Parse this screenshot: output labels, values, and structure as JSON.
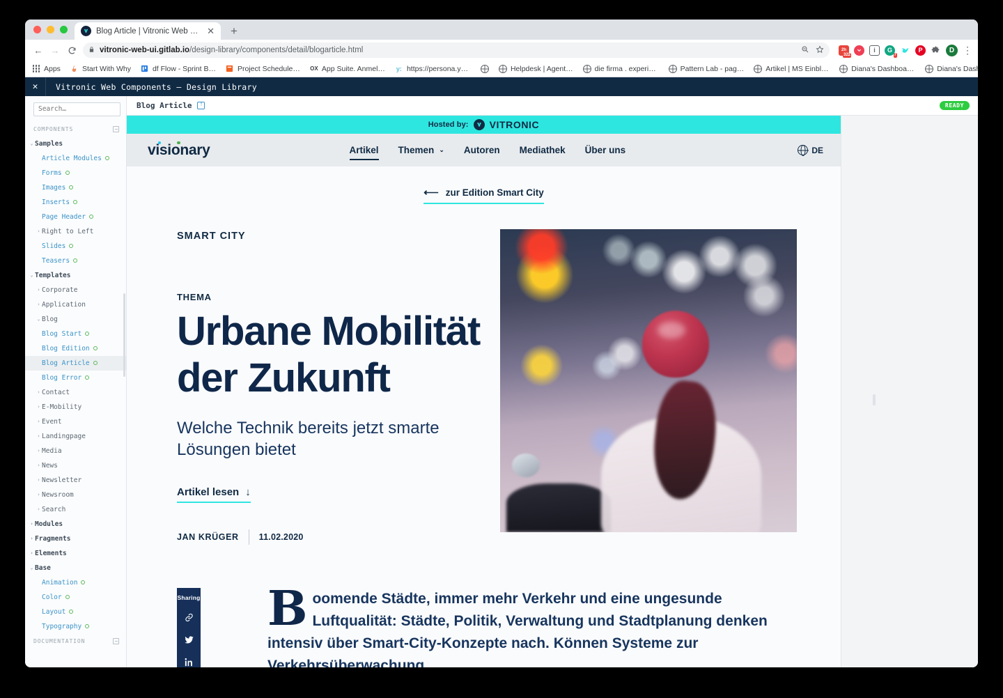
{
  "browser": {
    "tab": {
      "title": "Blog Article | Vitronic Web Com",
      "close": "✕",
      "favicon": "vitronic-favicon"
    },
    "newtab_label": "+",
    "nav": {
      "back": "←",
      "forward": "→",
      "reload": "C"
    },
    "omnibox": {
      "lock": "🔒",
      "url_host": "vitronic-web-ui.gitlab.io",
      "url_path": "/design-library/components/detail/blogarticle.html",
      "zoom_icon": "⊖",
      "star_icon": "☆"
    },
    "extensions": [
      {
        "name": "tab-counter-extension",
        "label": "2h",
        "badge": "322",
        "color": "#e8453c"
      },
      {
        "name": "pocket-extension",
        "label": "",
        "color": "#ef3f56"
      },
      {
        "name": "info-extension",
        "label": "",
        "color": "#ffffff"
      },
      {
        "name": "grammarly-extension",
        "label": "G",
        "badge": "7",
        "color": "#11a683"
      },
      {
        "name": "bird-extension",
        "label": "",
        "color": "#2ee6e0"
      },
      {
        "name": "pinterest-extension",
        "label": "",
        "color": "#e60023"
      },
      {
        "name": "puzzle-extension",
        "label": "",
        "color": "#5f6368"
      }
    ],
    "profile_initial": "D",
    "menu_icon": "⋮",
    "bookmarks": [
      {
        "label": "Apps",
        "icon": "apps-grid-icon"
      },
      {
        "label": "Start With Why",
        "icon": "flame-icon"
      },
      {
        "label": "df Flow - Sprint B…",
        "icon": "board-icon"
      },
      {
        "label": "Project Schedule…",
        "icon": "sheet-icon"
      },
      {
        "label": "App Suite. Anmel…",
        "icon": "ox-icon"
      },
      {
        "label": "https://persona.ya…",
        "icon": "y-icon"
      },
      {
        "label": "",
        "icon": "globe-icon"
      },
      {
        "label": "Helpdesk | Agent…",
        "icon": "globe-icon"
      },
      {
        "label": "die firma . experie…",
        "icon": "globe-icon"
      },
      {
        "label": "Pattern Lab - pag…",
        "icon": "globe-icon"
      },
      {
        "label": "Artikel | MS Einblick",
        "icon": "globe-icon"
      },
      {
        "label": "Diana's Dashboar…",
        "icon": "globe-icon"
      },
      {
        "label": "Diana's Dashboar…",
        "icon": "globe-icon"
      }
    ]
  },
  "app": {
    "close_label": "✕",
    "title": "Vitronic Web Components — Design Library",
    "search_placeholder": "Search…",
    "search_value": "",
    "sections": [
      {
        "label": "COMPONENTS",
        "toggle": "collapse-icon"
      },
      {
        "label": "DOCUMENTATION",
        "toggle": "collapse-icon"
      }
    ],
    "tree": [
      {
        "label": "Samples",
        "level": 1,
        "caret": "⌄",
        "status": false
      },
      {
        "label": "Article Modules",
        "level": 3,
        "caret": "",
        "status": true
      },
      {
        "label": "Forms",
        "level": 3,
        "caret": "",
        "status": true
      },
      {
        "label": "Images",
        "level": 3,
        "caret": "",
        "status": true
      },
      {
        "label": "Inserts",
        "level": 3,
        "caret": "",
        "status": true
      },
      {
        "label": "Page Header",
        "level": 3,
        "caret": "",
        "status": true
      },
      {
        "label": "Right to Left",
        "level": 2,
        "caret": "›",
        "status": false
      },
      {
        "label": "Slides",
        "level": 3,
        "caret": "",
        "status": true
      },
      {
        "label": "Teasers",
        "level": 3,
        "caret": "",
        "status": true
      },
      {
        "label": "Templates",
        "level": 1,
        "caret": "⌄",
        "status": false
      },
      {
        "label": "Corporate",
        "level": 2,
        "caret": "›",
        "status": false
      },
      {
        "label": "Application",
        "level": 2,
        "caret": "›",
        "status": false
      },
      {
        "label": "Blog",
        "level": 2,
        "caret": "⌄",
        "status": false
      },
      {
        "label": "Blog Start",
        "level": 3,
        "caret": "",
        "status": true
      },
      {
        "label": "Blog Edition",
        "level": 3,
        "caret": "",
        "status": true
      },
      {
        "label": "Blog Article",
        "level": 3,
        "caret": "",
        "status": true,
        "active": true
      },
      {
        "label": "Blog Error",
        "level": 3,
        "caret": "",
        "status": true
      },
      {
        "label": "Contact",
        "level": 2,
        "caret": "›",
        "status": false
      },
      {
        "label": "E-Mobility",
        "level": 2,
        "caret": "›",
        "status": false
      },
      {
        "label": "Event",
        "level": 2,
        "caret": "›",
        "status": false
      },
      {
        "label": "Landingpage",
        "level": 2,
        "caret": "›",
        "status": false
      },
      {
        "label": "Media",
        "level": 2,
        "caret": "›",
        "status": false
      },
      {
        "label": "News",
        "level": 2,
        "caret": "›",
        "status": false
      },
      {
        "label": "Newsletter",
        "level": 2,
        "caret": "›",
        "status": false
      },
      {
        "label": "Newsroom",
        "level": 2,
        "caret": "›",
        "status": false
      },
      {
        "label": "Search",
        "level": 2,
        "caret": "›",
        "status": false
      },
      {
        "label": "Modules",
        "level": 1,
        "caret": "›",
        "status": false
      },
      {
        "label": "Fragments",
        "level": 1,
        "caret": "›",
        "status": false
      },
      {
        "label": "Elements",
        "level": 1,
        "caret": "›",
        "status": false
      },
      {
        "label": "Base",
        "level": 1,
        "caret": "⌄",
        "status": false
      },
      {
        "label": "Animation",
        "level": 3,
        "caret": "",
        "status": true
      },
      {
        "label": "Color",
        "level": 3,
        "caret": "",
        "status": true
      },
      {
        "label": "Layout",
        "level": 3,
        "caret": "",
        "status": true
      },
      {
        "label": "Typography",
        "level": 3,
        "caret": "",
        "status": true
      }
    ],
    "main_header": {
      "title": "Blog Article",
      "external_icon": "external-link-icon",
      "status_badge": "READY"
    }
  },
  "preview": {
    "hosted_bar": {
      "prefix": "Hosted by:",
      "brand": "VITRONIC",
      "bg": "#2ee6e0"
    },
    "site_nav": {
      "logo": "visionary",
      "links": [
        {
          "label": "Artikel",
          "active": true,
          "chevron": ""
        },
        {
          "label": "Themen",
          "active": false,
          "chevron": "⌄"
        },
        {
          "label": "Autoren",
          "active": false,
          "chevron": ""
        },
        {
          "label": "Mediathek",
          "active": false,
          "chevron": ""
        },
        {
          "label": "Über uns",
          "active": false,
          "chevron": ""
        }
      ],
      "language": "DE",
      "globe_icon": "globe-icon"
    },
    "back_link": {
      "arrow": "⟵",
      "label": "zur Edition Smart City"
    },
    "article": {
      "kicker": "SMART CITY",
      "thema_label": "THEMA",
      "headline": "Urbane Mobilität\nder Zukunft",
      "subline": "Welche Technik bereits jetzt smarte\nLösungen bietet",
      "read_link": {
        "label": "Artikel lesen",
        "arrow": "↓"
      },
      "author": "JAN KRÜGER",
      "date": "11.02.2020",
      "image_alt": "Frau mit rotem Helm auf Roller in nächtlicher Stadt"
    },
    "sharing": {
      "title": "Sharing",
      "items": [
        {
          "name": "link-icon",
          "glyph": "🔗"
        },
        {
          "name": "twitter-icon",
          "glyph": ""
        },
        {
          "name": "linkedin-icon",
          "glyph": "in"
        }
      ]
    },
    "body": {
      "dropcap": "B",
      "text": "oomende Städte, immer mehr Verkehr und eine ungesunde Luftqualität: Städte, Politik, Verwaltung und Stadtplanung denken intensiv über Smart-City-Konzepte nach. Können Systeme zur Verkehrsüberwachung"
    }
  },
  "colors": {
    "accent_teal": "#2ee6e0",
    "navy": "#102a43",
    "headline_navy": "#0f2749",
    "ready_green": "#2ecc40",
    "tree_link": "#3b93c9"
  }
}
